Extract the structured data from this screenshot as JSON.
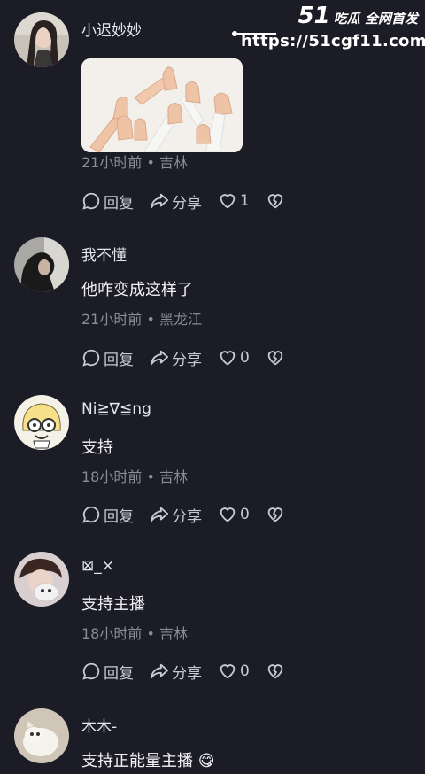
{
  "watermark": {
    "brand_number": "51",
    "brand_text": "吃瓜 全网首发",
    "url": "https://51cgf11.com"
  },
  "actions_labels": {
    "reply": "回复",
    "share": "分享"
  },
  "comments": [
    {
      "username": "小迟妙妙",
      "text": "",
      "meta": "21小时前 • 吉林",
      "likes": "1",
      "has_image": true
    },
    {
      "username": "我不懂",
      "text": "他咋变成这样了",
      "meta": "21小时前 • 黑龙江",
      "likes": "0"
    },
    {
      "username": "Ni≧∇≦ng",
      "text": "支持",
      "meta": "18小时前 • 吉林",
      "likes": "0"
    },
    {
      "username": "⊠_×",
      "text": "支持主播",
      "meta": "18小时前 • 吉林",
      "likes": "0"
    },
    {
      "username": "木木-",
      "text": "支持正能量主播",
      "emoji": "😋"
    }
  ]
}
